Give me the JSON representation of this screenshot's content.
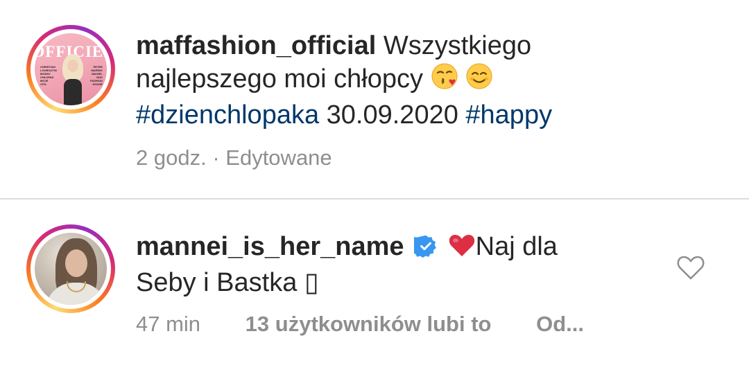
{
  "post": {
    "username": "maffashion_official",
    "caption_part1": "Wszystkiego",
    "caption_part2": "najlepszego moi chłopcy",
    "hashtag1": "#dzienchlopaka",
    "date": "30.09.2020",
    "hashtag2": "#happy",
    "time": "2 godz.",
    "separator": "·",
    "edited": "Edytowane",
    "avatar_magazine": {
      "title": "OFFICIEL",
      "left_lines": [
        "CHRISTIAN",
        "LOUBOUTIN",
        "MODNY",
        "CHŁOPAK",
        "MOJE",
        "VITA"
      ],
      "right_lines": [
        "PETER",
        "MARINO",
        "MAGIEL",
        "2020",
        "FASHION",
        "HOUSE"
      ]
    }
  },
  "comment": {
    "username": "mannei_is_her_name",
    "text_part1": "Naj dla",
    "text_part2": "Seby i Bastka",
    "trailing_glyph": "▯",
    "time": "47 min",
    "likes": "13 użytkowników lubi to",
    "reply": "Od..."
  },
  "colors": {
    "text": "#262626",
    "muted": "#8e8e8e",
    "hashtag": "#00376b",
    "verified": "#3897f0",
    "heart": "#ed4956",
    "divider": "#dbdbdb"
  },
  "icons": [
    "kiss-emoji-icon",
    "smiling-emoji-icon",
    "verified-badge-icon",
    "red-heart-emoji-icon",
    "like-heart-icon"
  ]
}
